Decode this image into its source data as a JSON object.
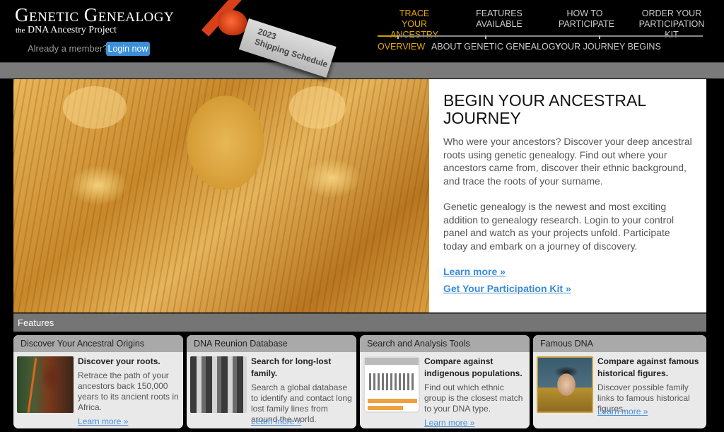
{
  "header": {
    "logo_title": "Genetic Genealogy",
    "logo_sub_small": "the",
    "logo_sub": "DNA Ancestry Project",
    "member_text": "Already a member?",
    "login_label": "Login now",
    "promo_tag": {
      "year": "2023",
      "label": "Shipping Schedule"
    }
  },
  "nav": {
    "top": [
      {
        "label": "TRACE YOUR ANCESTRY",
        "active": true
      },
      {
        "label": "FEATURES AVAILABLE",
        "active": false
      },
      {
        "label": "HOW TO PARTICIPATE",
        "active": false
      },
      {
        "label": "ORDER YOUR PARTICIPATION KIT",
        "active": false
      }
    ],
    "sub": [
      {
        "label": "OVERVIEW",
        "active": true
      },
      {
        "label": "ABOUT GENETIC GENEALOGY",
        "active": false
      },
      {
        "label": "YOUR JOURNEY BEGINS",
        "active": false
      }
    ]
  },
  "hero": {
    "image_alt": "Egyptian relief carving of two figures",
    "title": "BEGIN YOUR ANCESTRAL JOURNEY",
    "paragraphs": [
      "Who were your ancestors? Discover your deep ancestral roots using genetic genealogy. Find out where your ancestors came from, discover their ethnic background, and trace the roots of your surname.",
      "Genetic genealogy is the newest and most exciting addition to genealogy research. Login to your control panel and watch as your projects unfold. Participate today and embark on a journey of discovery."
    ],
    "links": [
      "Learn more »",
      "Get Your Participation Kit »"
    ]
  },
  "features": {
    "title": "Features",
    "cards": [
      {
        "header": "Discover Your Ancestral Origins",
        "subtitle": "Discover your roots.",
        "text": "Retrace the path of your ancestors back 150,000 years to its ancient roots in Africa.",
        "link": "Learn more »",
        "image": "african-warrior-photo"
      },
      {
        "header": "DNA Reunion Database",
        "subtitle": "Search for long-lost family.",
        "text": "Search a global database to identify and contact long lost family lines from around the world.",
        "link": "Learn more »",
        "image": "vintage-family-photo"
      },
      {
        "header": "Search and Analysis Tools",
        "subtitle": "Compare against indigenous populations.",
        "text": "Find out which ethnic group is the closest match to your DNA type.",
        "link": "Learn more »",
        "image": "analysis-tool-screenshot"
      },
      {
        "header": "Famous DNA",
        "subtitle": "Compare against famous historical figures.",
        "text": "Discover possible family links to famous historical figures.",
        "link": "Learn more »",
        "image": "historical-portrait"
      }
    ]
  }
}
